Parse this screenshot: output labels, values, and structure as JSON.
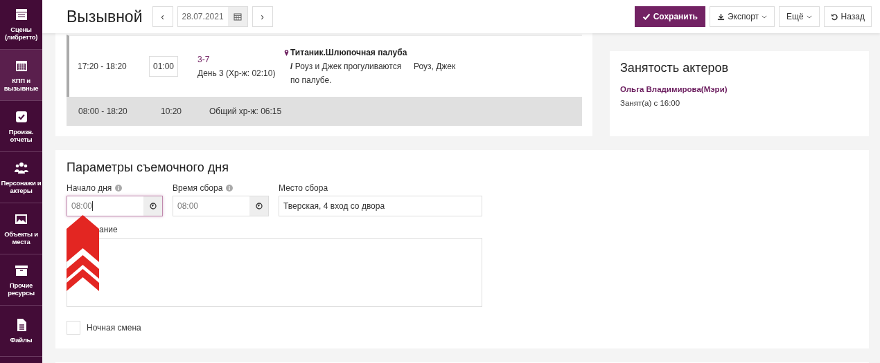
{
  "sidebar": {
    "items": [
      {
        "label": "Сцены (либретто)",
        "selected": false
      },
      {
        "label": "КПП и вызывные",
        "selected": true
      },
      {
        "label": "Произв. отчеты",
        "selected": false
      },
      {
        "label": "Персонажи и актеры",
        "selected": false
      },
      {
        "label": "Объекты и места",
        "selected": false
      },
      {
        "label": "Прочие ресурсы",
        "selected": false
      },
      {
        "label": "Файлы",
        "selected": false
      }
    ]
  },
  "header": {
    "title": "Вызывной",
    "date": "28.07.2021",
    "prev": "‹",
    "next": "›",
    "buttons": [
      {
        "label": "Сохранить",
        "kind": "primary"
      },
      {
        "label": "Экспорт",
        "kind": "dropdown"
      },
      {
        "label": "Ещё",
        "kind": "dropdown"
      },
      {
        "label": "Назад",
        "kind": "plain"
      }
    ]
  },
  "schedule": {
    "rows": [
      {
        "time": "17:20 - 18:20",
        "duration": "01:00",
        "scene": "3-7",
        "day": "День 3 (Хр-ж: 02:10)",
        "location": "**Титаник.Шлюпочная палуба /** Роуз и Джек прогуливаются по палубе.",
        "characters": "Роуз, Джек"
      }
    ],
    "total": {
      "time": "08:00 - 18:20",
      "duration": "10:20",
      "timing": "Общий хр-ж: 06:15"
    }
  },
  "actors_panel": {
    "title": "Занятость актеров",
    "entries": [
      {
        "name": "Ольга Владимирова(Мэри)",
        "status": "Занят(а) с 16:00"
      }
    ]
  },
  "day_params": {
    "title": "Параметры съемочного дня",
    "start": {
      "label": "Начало дня",
      "value": "08:00",
      "focused": true
    },
    "gathering_time": {
      "label": "Время сбора",
      "value": "08:00",
      "focused": false
    },
    "gathering_place": {
      "label": "Место сбора",
      "value": "Тверская, 4 вход со двора"
    },
    "note": {
      "label": "ание"
    },
    "night_shift": {
      "label": "Ночная смена",
      "checked": false
    }
  }
}
